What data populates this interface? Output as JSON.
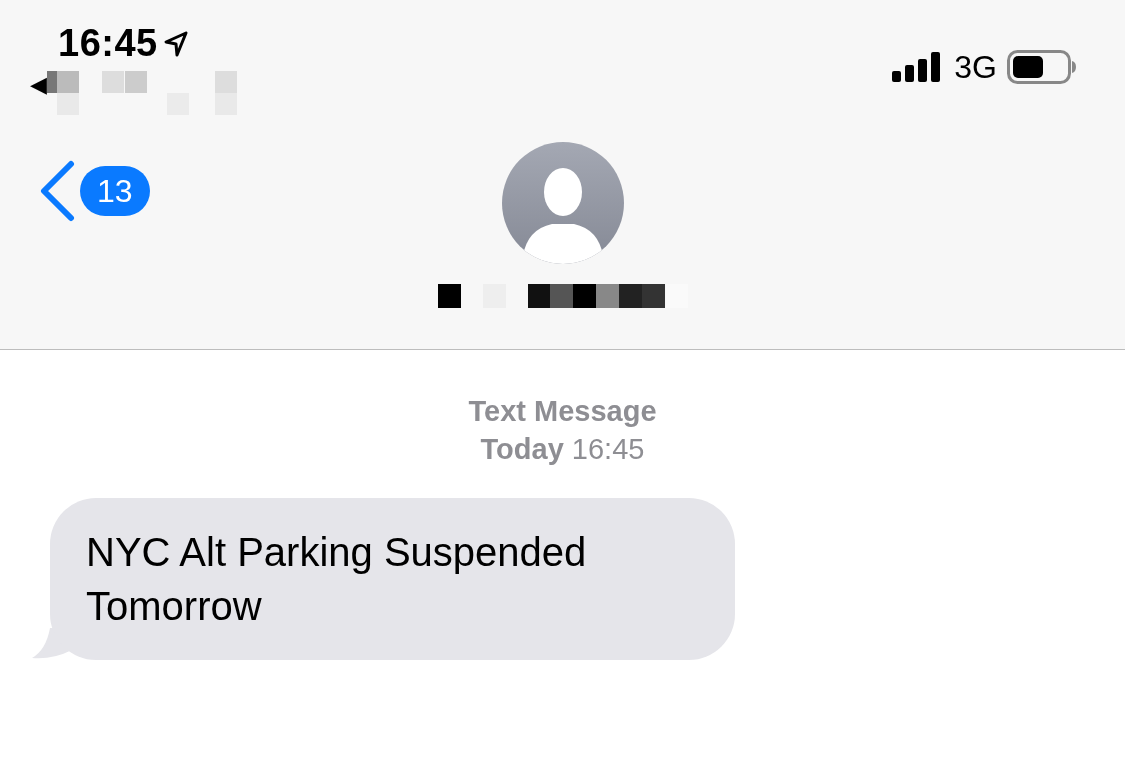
{
  "status_bar": {
    "time": "16:45",
    "back_app_arrow": "◀",
    "network": "3G"
  },
  "header": {
    "back_badge": "13"
  },
  "conversation": {
    "service_label": "Text Message",
    "timestamp": "**Today** 16:45",
    "messages": [
      {
        "kind": "received",
        "text": "NYC Alt Parking Suspended Tomorrow"
      }
    ]
  }
}
